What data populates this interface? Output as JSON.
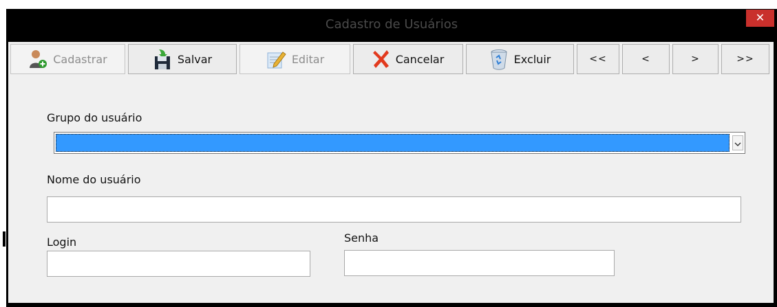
{
  "window": {
    "title": "Cadastro de Usuários",
    "close_glyph": "✕"
  },
  "toolbar": {
    "cadastrar": {
      "label": "Cadastrar",
      "icon": "user-add-icon",
      "enabled": false
    },
    "salvar": {
      "label": "Salvar",
      "icon": "save-floppy-icon",
      "enabled": true
    },
    "editar": {
      "label": "Editar",
      "icon": "edit-pencil-icon",
      "enabled": false
    },
    "cancelar": {
      "label": "Cancelar",
      "icon": "cancel-x-icon",
      "enabled": true
    },
    "excluir": {
      "label": "Excluir",
      "icon": "recycle-bin-icon",
      "enabled": true
    },
    "first": "<<",
    "prev": "<",
    "next": ">",
    "last": ">>"
  },
  "form": {
    "grupo_label": "Grupo do usuário",
    "grupo_value": "",
    "nome_label": "Nome do usuário",
    "nome_value": "",
    "login_label": "Login",
    "login_value": "",
    "senha_label": "Senha",
    "senha_value": ""
  },
  "colors": {
    "title_bar": "#000000",
    "close_button": "#c9302c",
    "selection": "#3399ff",
    "client_background": "#f0f0f0"
  }
}
